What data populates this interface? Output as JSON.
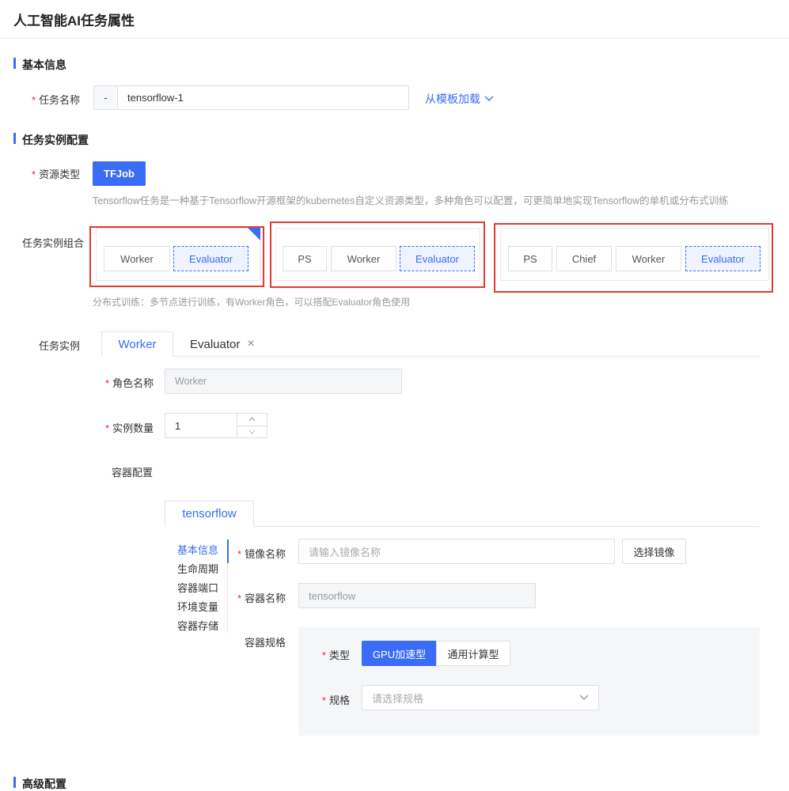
{
  "page": {
    "title": "人工智能AI任务属性"
  },
  "sections": {
    "basic": "基本信息",
    "instance_config": "任务实例配置",
    "advanced": "高级配置"
  },
  "task_name": {
    "label": "任务名称",
    "prefix": "-",
    "value": "tensorflow-1",
    "template_link": "从模板加载"
  },
  "resource_type": {
    "label": "资源类型",
    "button": "TFJob",
    "description": "Tensorflow任务是一种基于Tensorflow开源框架的kubernetes自定义资源类型，多种角色可以配置，可更简单地实现Tensorflow的单机或分布式训练"
  },
  "combo": {
    "label": "任务实例组合",
    "groups": [
      {
        "options": [
          "Worker",
          "Evaluator"
        ]
      },
      {
        "options": [
          "PS",
          "Worker",
          "Evaluator"
        ]
      },
      {
        "options": [
          "PS",
          "Chief",
          "Worker",
          "Evaluator"
        ]
      }
    ],
    "hint": "分布式训练：多节点进行训练，有Worker角色，可以搭配Evaluator角色使用"
  },
  "instances": {
    "label": "任务实例",
    "tabs": [
      "Worker",
      "Evaluator"
    ],
    "close_glyph": "×"
  },
  "role": {
    "label": "角色名称",
    "value": "Worker"
  },
  "count": {
    "label": "实例数量",
    "value": "1"
  },
  "container": {
    "label": "容器配置",
    "tab": "tensorflow",
    "side_menu": [
      "基本信息",
      "生命周期",
      "容器端口",
      "环境变量",
      "容器存储"
    ],
    "image": {
      "label": "镜像名称",
      "placeholder": "请输入镜像名称",
      "button": "选择镜像"
    },
    "name": {
      "label": "容器名称",
      "value": "tensorflow"
    },
    "spec": {
      "label": "容器规格",
      "type_label": "类型",
      "types": [
        "GPU加速型",
        "通用计算型"
      ],
      "size_label": "规格",
      "size_placeholder": "请选择规格"
    }
  },
  "colors": {
    "accent": "#3b6cf6",
    "highlight_frame": "#e53935"
  }
}
